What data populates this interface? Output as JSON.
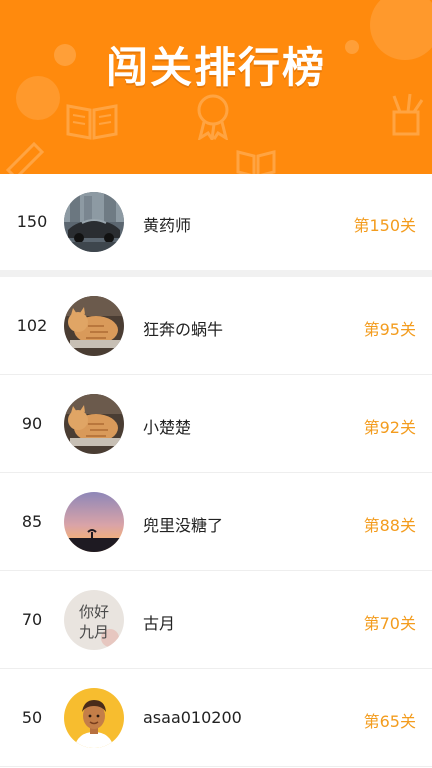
{
  "banner": {
    "title": "闯关排行榜",
    "background_color": "#ff8a0d"
  },
  "colors": {
    "accent": "#f39c1e",
    "divider": "#f1f1f1"
  },
  "my_rank": {
    "score": "150",
    "name": "黄药师",
    "level": "第150关",
    "avatar_icon": "car-photo-avatar"
  },
  "ranking": [
    {
      "score": "102",
      "name": "狂奔の蜗牛",
      "level": "第95关",
      "avatar_icon": "cat-photo-avatar"
    },
    {
      "score": "90",
      "name": "小楚楚",
      "level": "第92关",
      "avatar_icon": "cat-photo-avatar"
    },
    {
      "score": "85",
      "name": "兜里没糖了",
      "level": "第88关",
      "avatar_icon": "sunset-photo-avatar"
    },
    {
      "score": "70",
      "name": "古月",
      "level": "第70关",
      "avatar_icon": "calligraphy-avatar",
      "avatar_text": "你好九月"
    },
    {
      "score": "50",
      "name": "asaa010200",
      "level": "第65关",
      "avatar_icon": "cartoon-man-avatar"
    }
  ]
}
